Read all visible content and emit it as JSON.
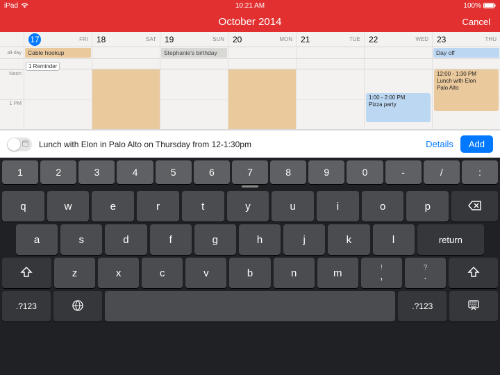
{
  "status": {
    "device": "iPad",
    "time": "10:21 AM",
    "battery": "100%"
  },
  "nav": {
    "title": "October 2014",
    "cancel": "Cancel"
  },
  "calendar": {
    "allday_label": "all-day",
    "hours": [
      "Noon",
      "1 PM"
    ],
    "days": [
      {
        "num": "17",
        "label": "FRI",
        "today": true
      },
      {
        "num": "18",
        "label": "SAT"
      },
      {
        "num": "19",
        "label": "SUN"
      },
      {
        "num": "20",
        "label": "MON"
      },
      {
        "num": "21",
        "label": "TUE"
      },
      {
        "num": "22",
        "label": "WED"
      },
      {
        "num": "23",
        "label": "THU"
      }
    ],
    "allday_events": [
      {
        "col": 0,
        "span": 1,
        "text": "Cable hookup",
        "cls": "ev-orange"
      },
      {
        "col": 2,
        "span": 1,
        "text": "Stephanie's birthday",
        "cls": "ev-gray"
      },
      {
        "col": 6,
        "span": 1,
        "text": "Day off",
        "cls": "ev-blue"
      }
    ],
    "reminder": {
      "col": 0,
      "text": "1 Reminder"
    },
    "orange_busy_cols": [
      1,
      3
    ],
    "timed_events": [
      {
        "col": 5,
        "cls": "te-blue",
        "line1": "1:00 - 2:00 PM",
        "line2": "Pizza party",
        "line3": ""
      },
      {
        "col": 6,
        "cls": "te-orange",
        "line1": "12:00 - 1:30 PM",
        "line2": "Lunch with Elon",
        "line3": "Palo Alto"
      }
    ]
  },
  "input": {
    "value": "Lunch with Elon in Palo Alto on Thursday from 12-1:30pm",
    "details": "Details",
    "add": "Add"
  },
  "keyboard": {
    "row0": [
      "1",
      "2",
      "3",
      "4",
      "5",
      "6",
      "7",
      "8",
      "9",
      "0",
      "-",
      "/",
      ":"
    ],
    "row1": [
      "q",
      "w",
      "e",
      "r",
      "t",
      "y",
      "u",
      "i",
      "o",
      "p"
    ],
    "row2": [
      "a",
      "s",
      "d",
      "f",
      "g",
      "h",
      "j",
      "k",
      "l"
    ],
    "return": "return",
    "row3": [
      "z",
      "x",
      "c",
      "v",
      "b",
      "n",
      "m"
    ],
    "row3_punct": [
      {
        "top": "!",
        "bot": ","
      },
      {
        "top": "?",
        "bot": "."
      }
    ],
    "symkey": ".?123"
  }
}
